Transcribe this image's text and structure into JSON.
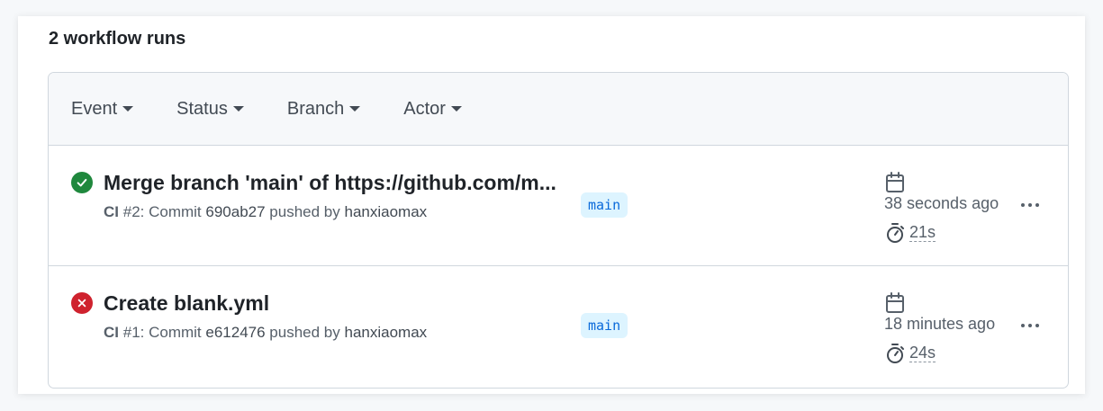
{
  "header": {
    "title": "2 workflow runs"
  },
  "filters": [
    {
      "label": "Event"
    },
    {
      "label": "Status"
    },
    {
      "label": "Branch"
    },
    {
      "label": "Actor"
    }
  ],
  "runs": [
    {
      "status": "success",
      "status_icon": "check-circle-fill-icon",
      "title": "Merge branch 'main' of https://github.com/m...",
      "workflow": "CI",
      "run_number": "#2",
      "commit_prefix": ": Commit ",
      "commit": "690ab27",
      "pushed_by": " pushed by ",
      "actor": "hanxiaomax",
      "branch": "main",
      "time": "38 seconds ago",
      "duration": "21s"
    },
    {
      "status": "failure",
      "status_icon": "x-circle-fill-icon",
      "title": "Create blank.yml",
      "workflow": "CI",
      "run_number": "#1",
      "commit_prefix": ": Commit ",
      "commit": "e612476",
      "pushed_by": " pushed by ",
      "actor": "hanxiaomax",
      "branch": "main",
      "time": "18 minutes ago",
      "duration": "24s"
    }
  ],
  "colors": {
    "success": "#1f883d",
    "failure": "#cf222e",
    "branch_bg": "#ddf4ff",
    "branch_text": "#0969da"
  }
}
